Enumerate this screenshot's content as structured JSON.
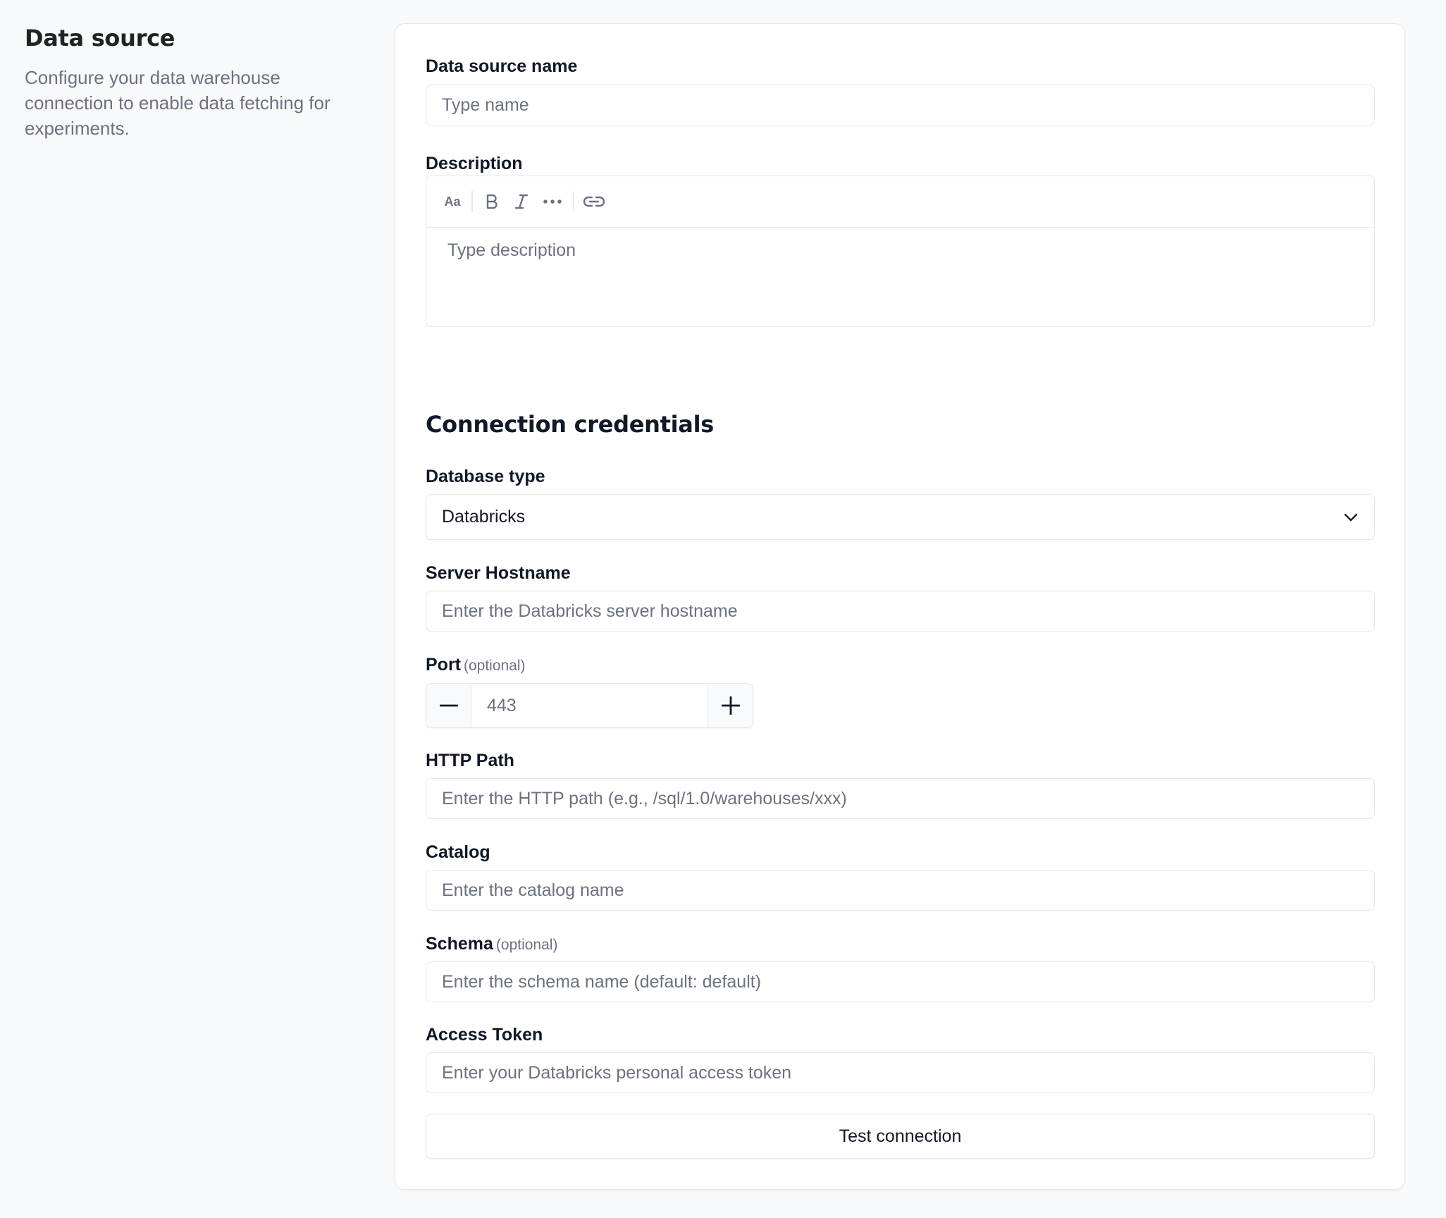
{
  "sidebar": {
    "title": "Data source",
    "description": "Configure your data warehouse connection to enable data fetching for experiments."
  },
  "form": {
    "name": {
      "label": "Data source name",
      "placeholder": "Type name"
    },
    "description": {
      "label": "Description",
      "placeholder": "Type description",
      "toolbar": [
        "text-size-icon",
        "bold-icon",
        "italic-icon",
        "more-icon",
        "link-icon"
      ]
    },
    "section_title": "Connection credentials",
    "database_type": {
      "label": "Database type",
      "value": "Databricks"
    },
    "server_hostname": {
      "label": "Server Hostname",
      "placeholder": "Enter the Databricks server hostname"
    },
    "port": {
      "label": "Port",
      "optional": "(optional)",
      "value": "443"
    },
    "http_path": {
      "label": "HTTP Path",
      "placeholder": "Enter the HTTP path (e.g., /sql/1.0/warehouses/xxx)"
    },
    "catalog": {
      "label": "Catalog",
      "placeholder": "Enter the catalog name"
    },
    "schema": {
      "label": "Schema",
      "optional": "(optional)",
      "placeholder": "Enter the schema name (default: default)"
    },
    "access_token": {
      "label": "Access Token",
      "placeholder": "Enter your Databricks personal access token"
    },
    "test_button": "Test connection"
  },
  "colors": {
    "background": "#f8f9fb",
    "card": "#ffffff",
    "border": "#e3e6ea",
    "muted_text": "#6b7280",
    "text": "#111827"
  }
}
